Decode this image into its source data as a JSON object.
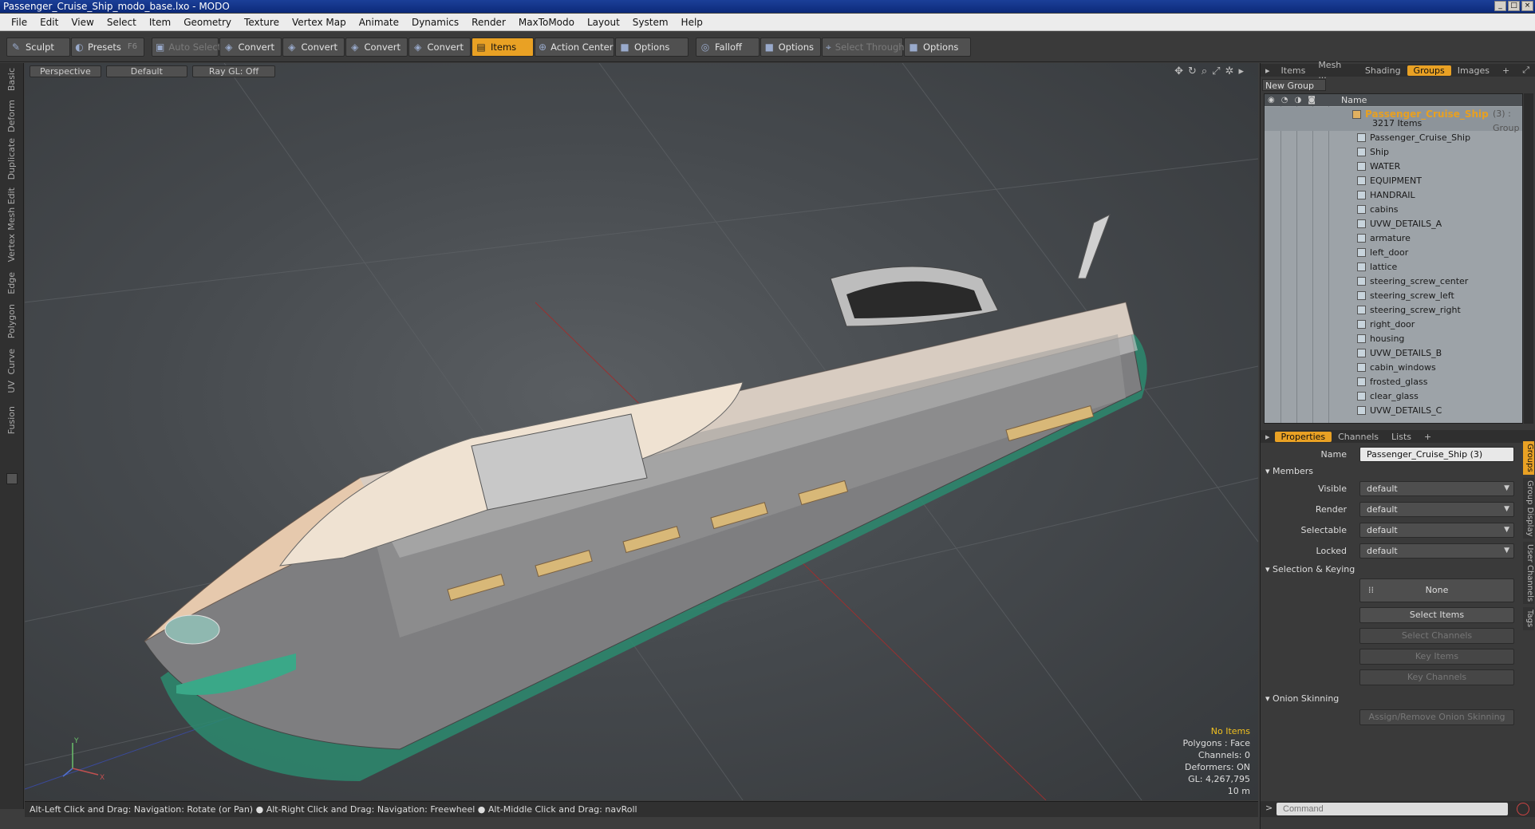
{
  "window": {
    "title": "Passenger_Cruise_Ship_modo_base.lxo - MODO"
  },
  "menu": [
    "File",
    "Edit",
    "View",
    "Select",
    "Item",
    "Geometry",
    "Texture",
    "Vertex Map",
    "Animate",
    "Dynamics",
    "Render",
    "MaxToModo",
    "Layout",
    "System",
    "Help"
  ],
  "toolbar": {
    "sculpt": "Sculpt",
    "presets": "Presets",
    "presets_key": "F6",
    "auto_select": "Auto Select",
    "convert1": "Convert",
    "convert2": "Convert",
    "convert3": "Convert",
    "convert4": "Convert",
    "items": "Items",
    "action_center": "Action Center",
    "options1": "Options",
    "falloff": "Falloff",
    "options2": "Options",
    "select_through": "Select Through",
    "options3": "Options"
  },
  "left_tabs": [
    "Basic",
    "Deform",
    "Duplicate",
    "Mesh Edit",
    "Vertex",
    "Edge",
    "Polygon",
    "Curve",
    "UV",
    "Fusion"
  ],
  "viewport": {
    "view": "Perspective",
    "shading": "Default",
    "raygl": "Ray GL: Off"
  },
  "overlay": {
    "items": "No Items",
    "polygons": "Polygons : Face",
    "channels": "Channels: 0",
    "deformers": "Deformers: ON",
    "gl": "GL: 4,267,795",
    "scale": "10 m"
  },
  "status": "Alt-Left Click and Drag: Navigation: Rotate (or Pan) ●  Alt-Right Click and Drag: Navigation: Freewheel ●  Alt-Middle Click and Drag: navRoll",
  "top_tabs": [
    "Items",
    "Mesh ...",
    "Shading",
    "Groups",
    "Images"
  ],
  "new_group": "New Group",
  "tree": {
    "col_name": "Name",
    "group": {
      "name": "Passenger_Cruise_Ship",
      "meta": "(3) : Group",
      "count": "3217 Items"
    },
    "items": [
      "Passenger_Cruise_Ship",
      "Ship",
      "WATER",
      "EQUIPMENT",
      "HANDRAIL",
      "cabins",
      "UVW_DETAILS_A",
      "armature",
      "left_door",
      "lattice",
      "steering_screw_center",
      "steering_screw_left",
      "steering_screw_right",
      "right_door",
      "housing",
      "UVW_DETAILS_B",
      "cabin_windows",
      "frosted_glass",
      "clear_glass",
      "UVW_DETAILS_C"
    ]
  },
  "prop_tabs": [
    "Properties",
    "Channels",
    "Lists"
  ],
  "props": {
    "name_label": "Name",
    "name_value": "Passenger_Cruise_Ship (3)",
    "members": "Members",
    "visible_label": "Visible",
    "visible": "default",
    "render_label": "Render",
    "render": "default",
    "selectable_label": "Selectable",
    "selectable": "default",
    "locked_label": "Locked",
    "locked": "default",
    "sel_keying": "Selection & Keying",
    "none": "None",
    "select_items": "Select Items",
    "select_channels": "Select Channels",
    "key_items": "Key Items",
    "key_channels": "Key Channels",
    "onion": "Onion Skinning",
    "onion_btn": "Assign/Remove Onion Skinning"
  },
  "side_tabs": [
    "Groups",
    "Group Display",
    "User Channels",
    "Tags"
  ],
  "command_placeholder": "Command"
}
